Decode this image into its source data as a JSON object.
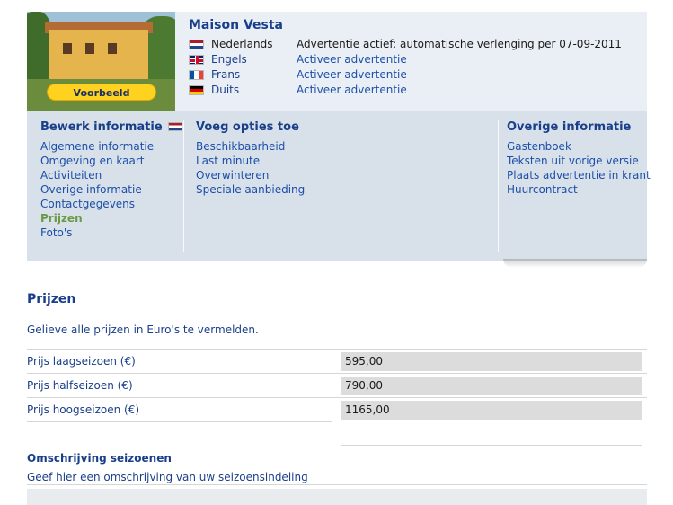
{
  "listing": {
    "title": "Maison Vesta",
    "preview_button": "Voorbeeld",
    "languages": [
      {
        "name": "Nederlands",
        "flag": "nl-flag-icon",
        "status": "Advertentie actief: automatische verlenging per 07-09-2011"
      },
      {
        "name": "Engels",
        "flag": "gb-flag-icon",
        "status": "Activeer advertentie"
      },
      {
        "name": "Frans",
        "flag": "fr-flag-icon",
        "status": "Activeer advertentie"
      },
      {
        "name": "Duits",
        "flag": "de-flag-icon",
        "status": "Activeer advertentie"
      }
    ]
  },
  "menu": {
    "edit": {
      "heading": "Bewerk informatie",
      "items": [
        "Algemene informatie",
        "Omgeving en kaart",
        "Activiteiten",
        "Overige informatie",
        "Contactgegevens",
        "Prijzen",
        "Foto's"
      ]
    },
    "options": {
      "heading": "Voeg opties toe",
      "items": [
        "Beschikbaarheid",
        "Last minute",
        "Overwinteren",
        "Speciale aanbieding"
      ]
    },
    "other": {
      "heading": "Overige informatie",
      "items": [
        "Gastenboek",
        "Teksten uit vorige versie",
        "Plaats advertentie in krant",
        "Huurcontract"
      ]
    }
  },
  "prices": {
    "title": "Prijzen",
    "intro": "Gelieve alle prijzen in Euro's te vermelden.",
    "rows": [
      {
        "label": "Prijs laagseizoen (€)",
        "value": "595,00"
      },
      {
        "label": "Prijs halfseizoen (€)",
        "value": "790,00"
      },
      {
        "label": "Prijs hoogseizoen (€)",
        "value": "1165,00"
      }
    ]
  },
  "seasons": {
    "title": "Omschrijving seizoenen",
    "help": "Geef hier een omschrijving van uw seizoensindeling"
  },
  "colors": {
    "header_bg": "#eaeff5",
    "menu_bg": "#d8e0ea",
    "link": "#1c4fa8",
    "active_item": "#6a9a45",
    "preview_button": "#ffd21f"
  }
}
